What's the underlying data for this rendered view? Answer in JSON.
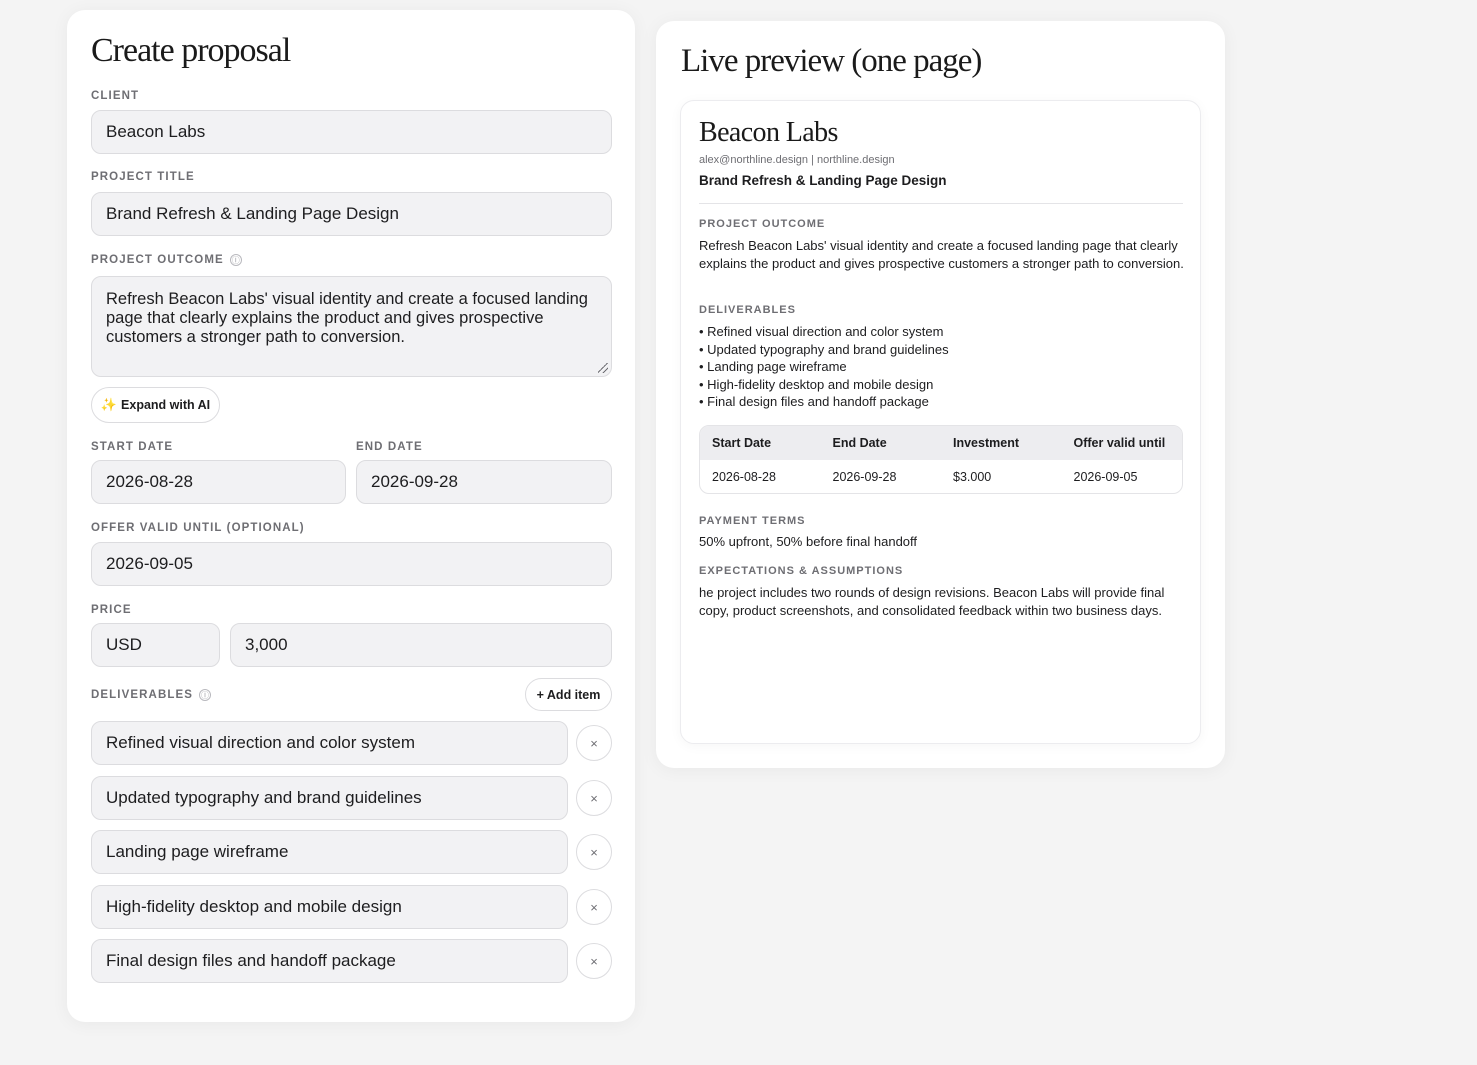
{
  "form": {
    "title": "Create proposal",
    "client": {
      "label": "CLIENT",
      "value": "Beacon Labs"
    },
    "project_title": {
      "label": "PROJECT TITLE",
      "value": "Brand Refresh & Landing Page Design"
    },
    "project_outcome": {
      "label": "PROJECT OUTCOME",
      "info_icon": "ⓘ",
      "value": "Refresh Beacon Labs' visual identity and create a focused landing page that clearly explains the product and gives prospective customers a stronger path to conversion."
    },
    "expand_ai": {
      "icon": "✨",
      "label": "Expand with AI"
    },
    "start_date": {
      "label": "START DATE",
      "value": "2026-08-28"
    },
    "end_date": {
      "label": "END DATE",
      "value": "2026-09-28"
    },
    "offer_valid": {
      "label": "OFFER VALID UNTIL (OPTIONAL)",
      "value": "2026-09-05"
    },
    "price": {
      "label": "PRICE",
      "currency": "USD",
      "amount": "3,000"
    },
    "deliverables": {
      "label": "DELIVERABLES",
      "info_icon": "ⓘ",
      "add_label": "+ Add item",
      "remove_glyph": "×",
      "items": [
        "Refined visual direction and color system",
        "Updated typography and brand guidelines",
        "Landing page wireframe",
        "High-fidelity desktop and mobile design",
        "Final design files and handoff package"
      ]
    }
  },
  "preview": {
    "title": "Live preview (one page)",
    "client": "Beacon Labs",
    "contact": "alex@northline.design | northline.design",
    "project": "Brand Refresh & Landing Page Design",
    "outcome_label": "PROJECT OUTCOME",
    "outcome_text": "Refresh Beacon Labs' visual identity and create a focused landing page that clearly explains the product and gives prospective customers a stronger path to conversion.",
    "deliverables_label": "DELIVERABLES",
    "deliverables": [
      "Refined visual direction and color system",
      "Updated typography and brand guidelines",
      "Landing page wireframe",
      "High-fidelity desktop and mobile design",
      "Final design files and handoff package"
    ],
    "table": {
      "headers": [
        "Start Date",
        "End Date",
        "Investment",
        "Offer valid until"
      ],
      "values": [
        "2026-08-28",
        "2026-09-28",
        "$3.000",
        "2026-09-05"
      ]
    },
    "payment_label": "PAYMENT TERMS",
    "payment_text": "50% upfront, 50% before final handoff",
    "expectations_label": "EXPECTATIONS & ASSUMPTIONS",
    "expectations_text": "he project includes two rounds of design revisions. Beacon Labs will provide final copy, product screenshots, and consolidated feedback within two business days."
  },
  "colors": {
    "page_bg": "#f4f4f4",
    "card_bg": "#ffffff",
    "field_bg": "#f2f2f4",
    "label": "#6e6e73",
    "sparkle": "#f5b400"
  }
}
